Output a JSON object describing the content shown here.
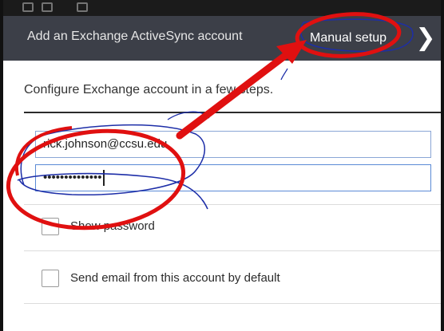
{
  "actionbar": {
    "title": "Add an Exchange ActiveSync account",
    "manual_setup_label": "Manual setup",
    "next_glyph": "❯"
  },
  "form": {
    "subtitle": "Configure Exchange account in a few steps.",
    "email_value": "rick.johnson@ccsu.edu",
    "password_value": "••••••••••••••"
  },
  "options": {
    "show_password_label": "Show password",
    "send_default_label": "Send email from this account by default"
  },
  "colors": {
    "actionbar_bg": "#3c3f48",
    "annotation_red": "#e01010",
    "annotation_blue": "#1d2ea8"
  },
  "icons": [
    "next-chevron-icon",
    "notification-icon"
  ]
}
